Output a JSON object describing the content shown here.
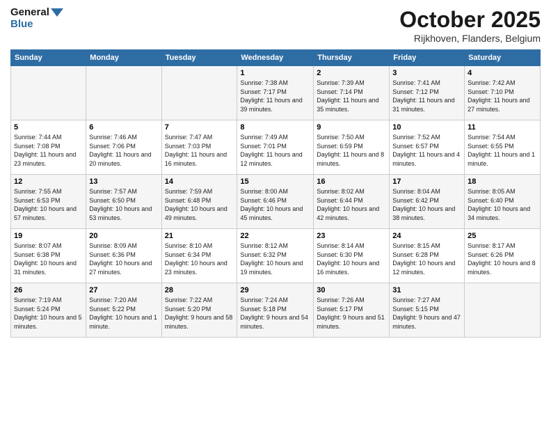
{
  "header": {
    "logo_line1": "General",
    "logo_line2": "Blue",
    "month": "October 2025",
    "location": "Rijkhoven, Flanders, Belgium"
  },
  "days_of_week": [
    "Sunday",
    "Monday",
    "Tuesday",
    "Wednesday",
    "Thursday",
    "Friday",
    "Saturday"
  ],
  "weeks": [
    [
      {
        "day": "",
        "sunrise": "",
        "sunset": "",
        "daylight": ""
      },
      {
        "day": "",
        "sunrise": "",
        "sunset": "",
        "daylight": ""
      },
      {
        "day": "",
        "sunrise": "",
        "sunset": "",
        "daylight": ""
      },
      {
        "day": "1",
        "sunrise": "Sunrise: 7:38 AM",
        "sunset": "Sunset: 7:17 PM",
        "daylight": "Daylight: 11 hours and 39 minutes."
      },
      {
        "day": "2",
        "sunrise": "Sunrise: 7:39 AM",
        "sunset": "Sunset: 7:14 PM",
        "daylight": "Daylight: 11 hours and 35 minutes."
      },
      {
        "day": "3",
        "sunrise": "Sunrise: 7:41 AM",
        "sunset": "Sunset: 7:12 PM",
        "daylight": "Daylight: 11 hours and 31 minutes."
      },
      {
        "day": "4",
        "sunrise": "Sunrise: 7:42 AM",
        "sunset": "Sunset: 7:10 PM",
        "daylight": "Daylight: 11 hours and 27 minutes."
      }
    ],
    [
      {
        "day": "5",
        "sunrise": "Sunrise: 7:44 AM",
        "sunset": "Sunset: 7:08 PM",
        "daylight": "Daylight: 11 hours and 23 minutes."
      },
      {
        "day": "6",
        "sunrise": "Sunrise: 7:46 AM",
        "sunset": "Sunset: 7:06 PM",
        "daylight": "Daylight: 11 hours and 20 minutes."
      },
      {
        "day": "7",
        "sunrise": "Sunrise: 7:47 AM",
        "sunset": "Sunset: 7:03 PM",
        "daylight": "Daylight: 11 hours and 16 minutes."
      },
      {
        "day": "8",
        "sunrise": "Sunrise: 7:49 AM",
        "sunset": "Sunset: 7:01 PM",
        "daylight": "Daylight: 11 hours and 12 minutes."
      },
      {
        "day": "9",
        "sunrise": "Sunrise: 7:50 AM",
        "sunset": "Sunset: 6:59 PM",
        "daylight": "Daylight: 11 hours and 8 minutes."
      },
      {
        "day": "10",
        "sunrise": "Sunrise: 7:52 AM",
        "sunset": "Sunset: 6:57 PM",
        "daylight": "Daylight: 11 hours and 4 minutes."
      },
      {
        "day": "11",
        "sunrise": "Sunrise: 7:54 AM",
        "sunset": "Sunset: 6:55 PM",
        "daylight": "Daylight: 11 hours and 1 minute."
      }
    ],
    [
      {
        "day": "12",
        "sunrise": "Sunrise: 7:55 AM",
        "sunset": "Sunset: 6:53 PM",
        "daylight": "Daylight: 10 hours and 57 minutes."
      },
      {
        "day": "13",
        "sunrise": "Sunrise: 7:57 AM",
        "sunset": "Sunset: 6:50 PM",
        "daylight": "Daylight: 10 hours and 53 minutes."
      },
      {
        "day": "14",
        "sunrise": "Sunrise: 7:59 AM",
        "sunset": "Sunset: 6:48 PM",
        "daylight": "Daylight: 10 hours and 49 minutes."
      },
      {
        "day": "15",
        "sunrise": "Sunrise: 8:00 AM",
        "sunset": "Sunset: 6:46 PM",
        "daylight": "Daylight: 10 hours and 45 minutes."
      },
      {
        "day": "16",
        "sunrise": "Sunrise: 8:02 AM",
        "sunset": "Sunset: 6:44 PM",
        "daylight": "Daylight: 10 hours and 42 minutes."
      },
      {
        "day": "17",
        "sunrise": "Sunrise: 8:04 AM",
        "sunset": "Sunset: 6:42 PM",
        "daylight": "Daylight: 10 hours and 38 minutes."
      },
      {
        "day": "18",
        "sunrise": "Sunrise: 8:05 AM",
        "sunset": "Sunset: 6:40 PM",
        "daylight": "Daylight: 10 hours and 34 minutes."
      }
    ],
    [
      {
        "day": "19",
        "sunrise": "Sunrise: 8:07 AM",
        "sunset": "Sunset: 6:38 PM",
        "daylight": "Daylight: 10 hours and 31 minutes."
      },
      {
        "day": "20",
        "sunrise": "Sunrise: 8:09 AM",
        "sunset": "Sunset: 6:36 PM",
        "daylight": "Daylight: 10 hours and 27 minutes."
      },
      {
        "day": "21",
        "sunrise": "Sunrise: 8:10 AM",
        "sunset": "Sunset: 6:34 PM",
        "daylight": "Daylight: 10 hours and 23 minutes."
      },
      {
        "day": "22",
        "sunrise": "Sunrise: 8:12 AM",
        "sunset": "Sunset: 6:32 PM",
        "daylight": "Daylight: 10 hours and 19 minutes."
      },
      {
        "day": "23",
        "sunrise": "Sunrise: 8:14 AM",
        "sunset": "Sunset: 6:30 PM",
        "daylight": "Daylight: 10 hours and 16 minutes."
      },
      {
        "day": "24",
        "sunrise": "Sunrise: 8:15 AM",
        "sunset": "Sunset: 6:28 PM",
        "daylight": "Daylight: 10 hours and 12 minutes."
      },
      {
        "day": "25",
        "sunrise": "Sunrise: 8:17 AM",
        "sunset": "Sunset: 6:26 PM",
        "daylight": "Daylight: 10 hours and 8 minutes."
      }
    ],
    [
      {
        "day": "26",
        "sunrise": "Sunrise: 7:19 AM",
        "sunset": "Sunset: 5:24 PM",
        "daylight": "Daylight: 10 hours and 5 minutes."
      },
      {
        "day": "27",
        "sunrise": "Sunrise: 7:20 AM",
        "sunset": "Sunset: 5:22 PM",
        "daylight": "Daylight: 10 hours and 1 minute."
      },
      {
        "day": "28",
        "sunrise": "Sunrise: 7:22 AM",
        "sunset": "Sunset: 5:20 PM",
        "daylight": "Daylight: 9 hours and 58 minutes."
      },
      {
        "day": "29",
        "sunrise": "Sunrise: 7:24 AM",
        "sunset": "Sunset: 5:18 PM",
        "daylight": "Daylight: 9 hours and 54 minutes."
      },
      {
        "day": "30",
        "sunrise": "Sunrise: 7:26 AM",
        "sunset": "Sunset: 5:17 PM",
        "daylight": "Daylight: 9 hours and 51 minutes."
      },
      {
        "day": "31",
        "sunrise": "Sunrise: 7:27 AM",
        "sunset": "Sunset: 5:15 PM",
        "daylight": "Daylight: 9 hours and 47 minutes."
      },
      {
        "day": "",
        "sunrise": "",
        "sunset": "",
        "daylight": ""
      }
    ]
  ]
}
